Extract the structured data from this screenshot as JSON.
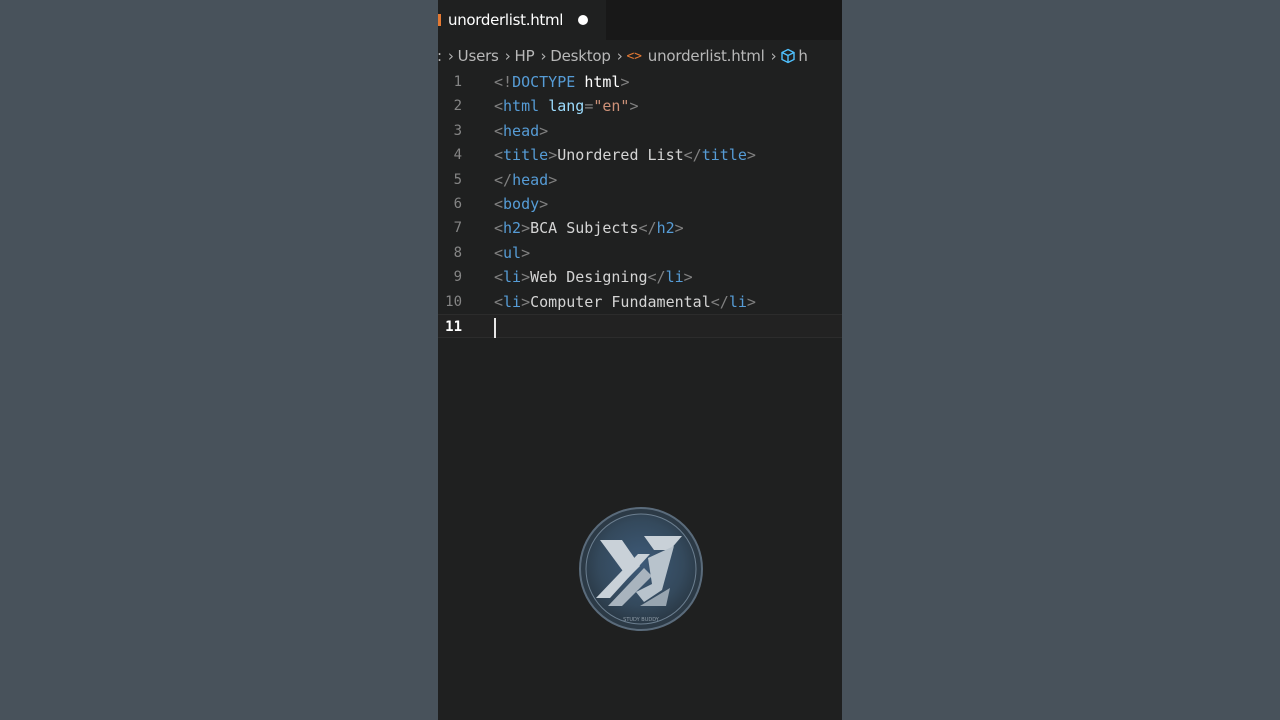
{
  "tab": {
    "filename": "unorderlist.html"
  },
  "breadcrumb": {
    "items": [
      "Users",
      "HP",
      "Desktop"
    ],
    "file": "unorderlist.html",
    "symbol": "h"
  },
  "editor": {
    "active_line": "11",
    "lines": [
      {
        "num": "1",
        "seg": [
          "<!",
          "DOCTYPE",
          " ",
          "html",
          ">"
        ]
      },
      {
        "num": "2",
        "seg": [
          "<",
          "html",
          " ",
          "lang",
          "=",
          "\"en\"",
          ">"
        ]
      },
      {
        "num": "3",
        "seg": [
          "<",
          "head",
          ">"
        ]
      },
      {
        "num": "4",
        "seg": [
          "<",
          "title",
          ">",
          "Unordered List",
          "</",
          "title",
          ">"
        ]
      },
      {
        "num": "5",
        "seg": [
          "</",
          "head",
          ">"
        ]
      },
      {
        "num": "6",
        "seg": [
          "<",
          "body",
          ">"
        ]
      },
      {
        "num": "7",
        "seg": [
          "<",
          "h2",
          ">",
          "BCA Subjects",
          "</",
          "h2",
          ">"
        ]
      },
      {
        "num": "8",
        "seg": [
          "<",
          "ul",
          ">"
        ]
      },
      {
        "num": "9",
        "seg": [
          "<",
          "li",
          ">",
          "Web Designing",
          "</",
          "li",
          ">"
        ]
      },
      {
        "num": "10",
        "seg": [
          "<",
          "li",
          ">",
          "Computer Fundamental",
          "</",
          "li",
          ">"
        ]
      }
    ]
  },
  "watermark": {
    "text": "STUDY BUDDY"
  },
  "colors": {
    "background": "#48525b",
    "editor_bg": "#1f2020",
    "tag": "#569cd6",
    "punctuation": "#808080",
    "attribute": "#9cdcfe",
    "string": "#ce9178",
    "file_icon": "#e37933",
    "symbol_icon": "#4fc1ff"
  }
}
